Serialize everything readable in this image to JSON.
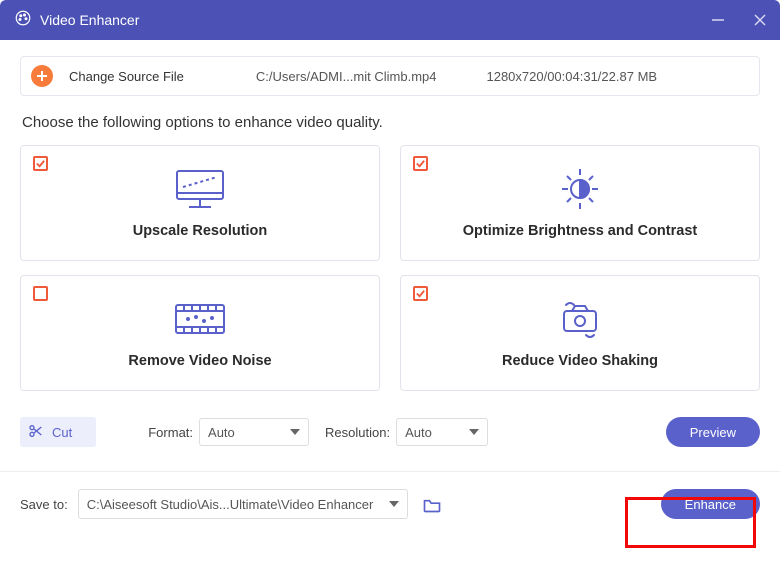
{
  "titlebar": {
    "title": "Video Enhancer"
  },
  "source": {
    "change_label": "Change Source File",
    "path": "C:/Users/ADMI...mit Climb.mp4",
    "meta": "1280x720/00:04:31/22.87 MB"
  },
  "instruction": "Choose the following options to enhance video quality.",
  "options": [
    {
      "label": "Upscale Resolution",
      "checked": true
    },
    {
      "label": "Optimize Brightness and Contrast",
      "checked": true
    },
    {
      "label": "Remove Video Noise",
      "checked": false
    },
    {
      "label": "Reduce Video Shaking",
      "checked": true
    }
  ],
  "controls": {
    "cut_label": "Cut",
    "format_label": "Format:",
    "format_value": "Auto",
    "resolution_label": "Resolution:",
    "resolution_value": "Auto",
    "preview_label": "Preview"
  },
  "save": {
    "label": "Save to:",
    "path": "C:\\Aiseesoft Studio\\Ais...Ultimate\\Video Enhancer",
    "enhance_label": "Enhance"
  }
}
